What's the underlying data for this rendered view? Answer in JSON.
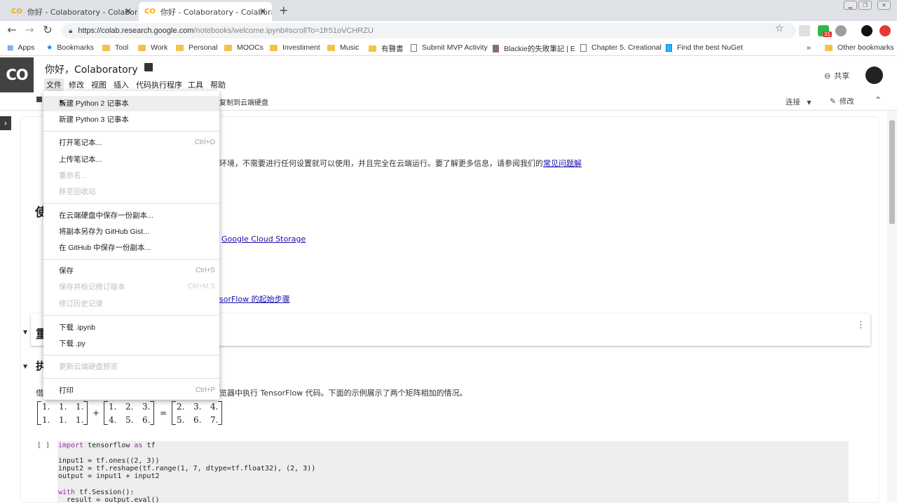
{
  "browser": {
    "tabs": [
      {
        "label": "你好 - Colaboratory - Colaborato",
        "active": false
      },
      {
        "label": "你好 - Colaboratory - Colaborato",
        "active": true
      }
    ],
    "new_tab_label": "+",
    "url_host": "https://colab.research.google.com",
    "url_path": "/notebooks/welcome.ipynb#scrollTo=1fr51oVCHRZU",
    "ext_badge": "31",
    "bookmarks": [
      {
        "label": "Apps"
      },
      {
        "label": "Bookmarks"
      },
      {
        "label": "Tool"
      },
      {
        "label": "Work"
      },
      {
        "label": "Personal"
      },
      {
        "label": "MOOCs"
      },
      {
        "label": "Investiment"
      },
      {
        "label": "Music"
      },
      {
        "label": "有聲書"
      },
      {
        "label": "Submit MVP Activity"
      },
      {
        "label": "Blackie的失敗筆記 | E"
      },
      {
        "label": "Chapter 5. Creational"
      },
      {
        "label": "Find the best NuGet"
      },
      {
        "label": "Other bookmarks"
      }
    ],
    "more": "»"
  },
  "colab": {
    "logo": "CO",
    "title": "你好，Colaboratory",
    "menus": [
      "文件",
      "修改",
      "视图",
      "插入",
      "代码执行程序",
      "工具",
      "帮助"
    ],
    "share_label": "共享",
    "toolbar": {
      "copy_label": "复制到云端硬盘",
      "connect_label": "连接",
      "edit_label": "修改"
    }
  },
  "content": {
    "intro_text": "环境，不需要进行任何设置就可以使用，并且完全在云端运行。要了解更多信息，请参阅我们的",
    "faq_link": "常见问题解",
    "heading_1_char": "使",
    "gcs_link": "Google Cloud Storage",
    "tf_link": "sorFlow 的起始步骤",
    "heading_2_char": "重",
    "heading_3_char": "执",
    "tf_desc_prefix": "借",
    "tf_desc": "览器中执行 TensorFlow 代码。下面的示例展示了两个矩阵相加的情况。",
    "cell_exec": "[ ]",
    "matrix_a": [
      [
        "1.",
        "1.",
        "1."
      ],
      [
        "1.",
        "1.",
        "1."
      ]
    ],
    "matrix_b": [
      [
        "1.",
        "2.",
        "3."
      ],
      [
        "4.",
        "5.",
        "6."
      ]
    ],
    "matrix_c": [
      [
        "2.",
        "3.",
        "4."
      ],
      [
        "5.",
        "6.",
        "7."
      ]
    ],
    "plus": "+",
    "equals": "=",
    "code": {
      "l1_kw": "import",
      "l1_rest": " tensorflow ",
      "l1_kw2": "as",
      "l1_end": " tf",
      "l3": "input1 = tf.ones((2, 3))",
      "l4": "input2 = tf.reshape(tf.range(1, 7, dtype=tf.float32), (2, 3))",
      "l5": "output = input1 + input2",
      "l7_kw": "with",
      "l7_rest": " tf.Session():",
      "l8": "  result = output.eval()"
    }
  },
  "file_menu": {
    "items": [
      {
        "label": "新建 Python 2 记事本",
        "shortcut": "",
        "disabled": false,
        "hover": true
      },
      {
        "label": "新建 Python 3 记事本",
        "shortcut": "",
        "disabled": false
      },
      {
        "label": "打开笔记本...",
        "shortcut": "Ctrl+O",
        "disabled": false
      },
      {
        "label": "上传笔记本...",
        "shortcut": "",
        "disabled": false
      },
      {
        "label": "重命名...",
        "shortcut": "",
        "disabled": true
      },
      {
        "label": "移至回收站",
        "shortcut": "",
        "disabled": true
      },
      {
        "label": "在云端硬盘中保存一份副本...",
        "shortcut": "",
        "disabled": false
      },
      {
        "label": "将副本另存为 GitHub Gist...",
        "shortcut": "",
        "disabled": false
      },
      {
        "label": "在 GitHub 中保存一份副本...",
        "shortcut": "",
        "disabled": false
      },
      {
        "label": "保存",
        "shortcut": "Ctrl+S",
        "disabled": false
      },
      {
        "label": "保存并标记修订版本",
        "shortcut": "Ctrl+M S",
        "disabled": true
      },
      {
        "label": "修订历史记录",
        "shortcut": "",
        "disabled": true
      },
      {
        "label": "下载 .ipynb",
        "shortcut": "",
        "disabled": false
      },
      {
        "label": "下载 .py",
        "shortcut": "",
        "disabled": false
      },
      {
        "label": "更新云端硬盘预览",
        "shortcut": "",
        "disabled": true
      },
      {
        "label": "打印",
        "shortcut": "Ctrl+P",
        "disabled": false
      }
    ]
  }
}
